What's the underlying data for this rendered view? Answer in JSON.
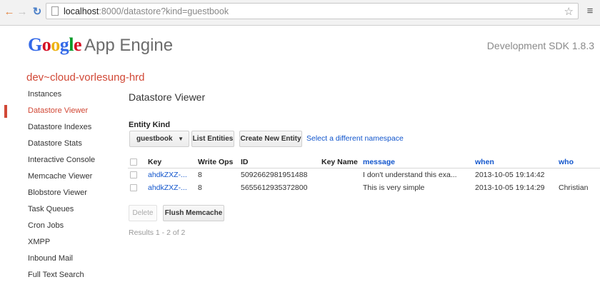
{
  "browser": {
    "url_host": "localhost",
    "url_path": ":8000/datastore?kind=guestbook",
    "back_icon": "back-arrow-icon",
    "forward_icon": "forward-arrow-icon",
    "reload_icon": "reload-icon",
    "star_icon": "bookmark-star-icon",
    "menu_icon": "menu-icon"
  },
  "header": {
    "logo_letters": [
      "G",
      "o",
      "o",
      "g",
      "l",
      "e"
    ],
    "logo_colors": [
      "#3369e8",
      "#d50f25",
      "#eeb211",
      "#3369e8",
      "#009925",
      "#d50f25"
    ],
    "product": "App Engine",
    "sdk_version": "Development SDK 1.8.3"
  },
  "app_id": "dev~cloud-vorlesung-hrd",
  "sidebar": {
    "items": [
      {
        "label": "Instances",
        "active": false
      },
      {
        "label": "Datastore Viewer",
        "active": true
      },
      {
        "label": "Datastore Indexes",
        "active": false
      },
      {
        "label": "Datastore Stats",
        "active": false
      },
      {
        "label": "Interactive Console",
        "active": false
      },
      {
        "label": "Memcache Viewer",
        "active": false
      },
      {
        "label": "Blobstore Viewer",
        "active": false
      },
      {
        "label": "Task Queues",
        "active": false
      },
      {
        "label": "Cron Jobs",
        "active": false
      },
      {
        "label": "XMPP",
        "active": false
      },
      {
        "label": "Inbound Mail",
        "active": false
      },
      {
        "label": "Full Text Search",
        "active": false
      }
    ]
  },
  "main": {
    "title": "Datastore Viewer",
    "entity_kind_label": "Entity Kind",
    "selected_kind": "guestbook",
    "list_entities": "List Entities",
    "create_entity": "Create New Entity",
    "namespace_link": "Select a different namespace",
    "table": {
      "headers": {
        "key": "Key",
        "write_ops": "Write Ops",
        "id": "ID",
        "key_name": "Key Name",
        "message": "message",
        "when": "when",
        "who": "who"
      },
      "rows": [
        {
          "key": "ahdkZXZ-...",
          "write_ops": "8",
          "id": "5092662981951488",
          "key_name": "",
          "message": "I don't understand this exa...",
          "when": "2013-10-05 19:14:42",
          "who": ""
        },
        {
          "key": "ahdkZXZ-...",
          "write_ops": "8",
          "id": "5655612935372800",
          "key_name": "",
          "message": "This is very simple",
          "when": "2013-10-05 19:14:29",
          "who": "Christian"
        }
      ]
    },
    "delete": "Delete",
    "flush_memcache": "Flush Memcache",
    "results": "Results 1 - 2 of 2"
  },
  "colors": {
    "accent_red": "#d14836",
    "link_blue": "#1155cc"
  }
}
